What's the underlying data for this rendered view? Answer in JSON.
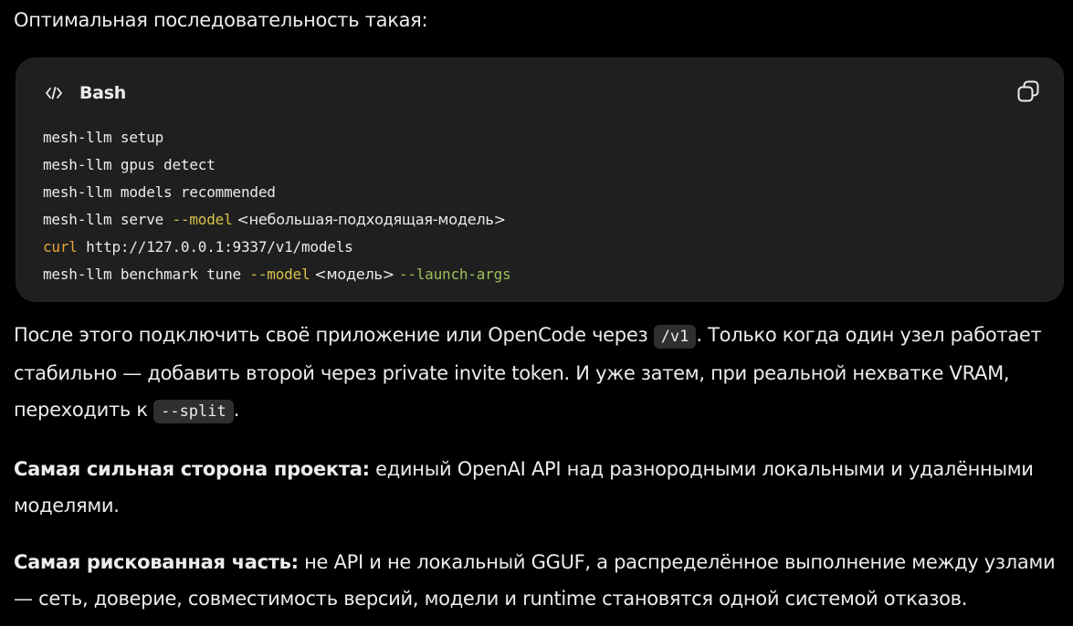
{
  "intro": "Оптимальная последовательность такая:",
  "code_block": {
    "language": "Bash",
    "language_icon": "code-icon",
    "copy_icon": "copy-icon",
    "lines": [
      [
        {
          "t": "mesh-llm setup"
        }
      ],
      [
        {
          "t": "mesh-llm gpus detect"
        }
      ],
      [
        {
          "t": "mesh-llm models recommended"
        }
      ],
      [
        {
          "t": "mesh-llm serve "
        },
        {
          "t": "--model",
          "c": "yellow"
        },
        {
          "t": " <небольшая-подходящая-модель>"
        }
      ],
      [
        {
          "t": "curl",
          "c": "orange"
        },
        {
          "t": " http://127.0.0.1:9337/v1/models"
        }
      ],
      [
        {
          "t": "mesh-llm benchmark tune "
        },
        {
          "t": "--model",
          "c": "yellow"
        },
        {
          "t": " <модель> "
        },
        {
          "t": "--launch-args",
          "c": "green"
        }
      ]
    ]
  },
  "after_code": {
    "line1_a": "После этого подключить своё приложение или OpenCode через ",
    "line1_code": "/v1",
    "line1_b": ". Только когда один узел работает",
    "line2": "стабильно — добавить второй через private invite token. И уже затем, при реальной нехватке VRAM,",
    "line3_a": "переходить к ",
    "line3_code": "--split",
    "line3_b": "."
  },
  "strength": {
    "label": "Самая сильная сторона проекта:",
    "line1_rest": " единый OpenAI API над разнородными локальными и удалёнными",
    "line2": "моделями."
  },
  "risk": {
    "label": "Самая рискованная часть:",
    "line1_rest": " не API и не локальный GGUF, а распределённое выполнение между узлами",
    "line2": "— сеть, доверие, совместимость версий, модели и runtime становятся одной системой отказов."
  }
}
